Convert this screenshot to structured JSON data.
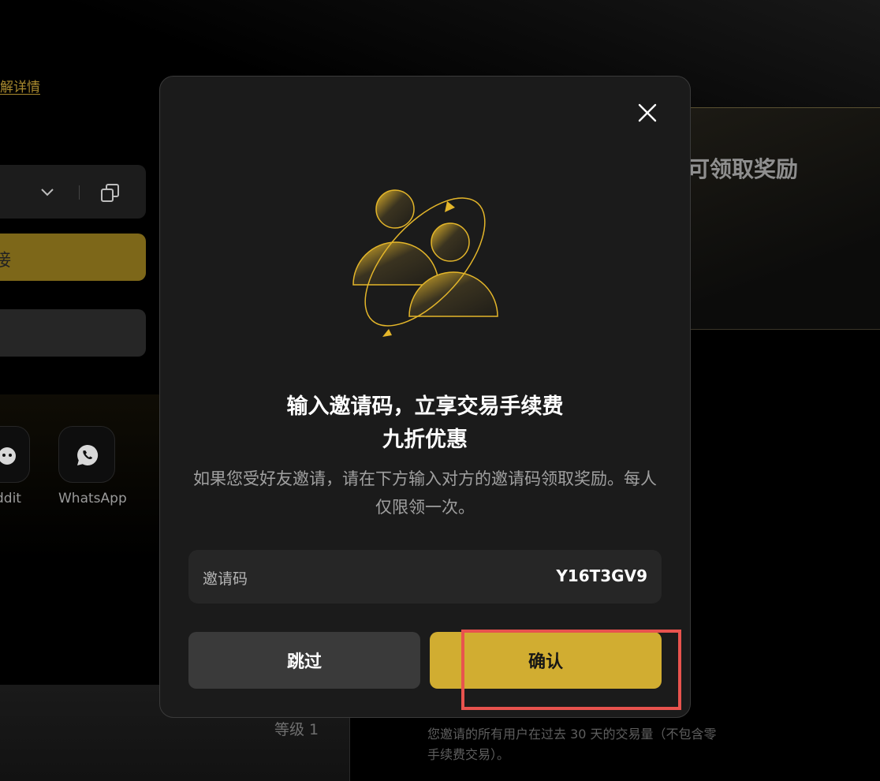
{
  "background": {
    "details_link": "解详情",
    "gold_button_label": "接",
    "share": {
      "reddit_label": "ddit",
      "whatsapp_label": "WhatsApp"
    },
    "right_panel_text": "可领取奖励",
    "level_label": "等级 1",
    "volume_note": "您邀请的所有用户在过去 30 天的交易量（不包含零手续费交易）。"
  },
  "modal": {
    "title_line1": "输入邀请码，立享交易手续费",
    "title_line2": "九折优惠",
    "description": "如果您受好友邀请，请在下方输入对方的邀请码领取奖励。每人仅限领一次。",
    "code_field": {
      "label": "邀请码",
      "value": "Y16T3GV9"
    },
    "skip_label": "跳过",
    "confirm_label": "确认"
  },
  "colors": {
    "accent_gold": "#d1ad31",
    "highlight_red": "#e8534e"
  }
}
